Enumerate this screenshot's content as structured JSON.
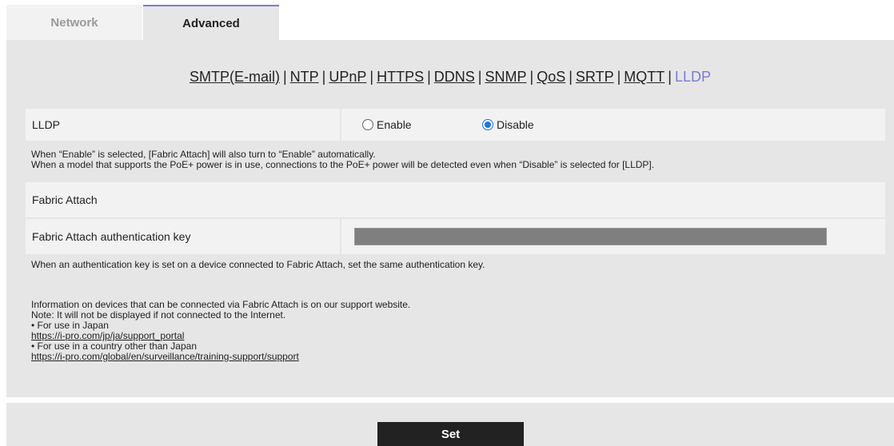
{
  "tabs": [
    {
      "label": "Network"
    },
    {
      "label": "Advanced"
    }
  ],
  "subnav": {
    "items": [
      "SMTP(E-mail)",
      "NTP",
      "UPnP",
      "HTTPS",
      "DDNS",
      "SNMP",
      "QoS",
      "SRTP",
      "MQTT",
      "LLDP"
    ],
    "separator": "|",
    "active": "LLDP"
  },
  "lldp": {
    "label": "LLDP",
    "options": [
      "Enable",
      "Disable"
    ],
    "selected": "Disable"
  },
  "notes": {
    "lldp_line1": "When “Enable” is selected, [Fabric Attach] will also turn to “Enable” automatically.",
    "lldp_line2": "When a model that supports the PoE+ power is in use, connections to the PoE+ power will be detected even when “Disable” is selected for [LLDP].",
    "auth_key": "When an authentication key is set on a device connected to Fabric Attach, set the same authentication key.",
    "info_line1": "Information on devices that can be connected via Fabric Attach is on our support website.",
    "info_line2": "Note: It will not be displayed if not connected to the Internet.",
    "japan_label": "• For use in Japan",
    "japan_link": "https://i-pro.com/jp/ja/support_portal",
    "other_label": "• For use in a country other than Japan",
    "other_link": "https://i-pro.com/global/en/surveillance/training-support/support"
  },
  "fabric_attach": {
    "label": "Fabric Attach"
  },
  "auth_key": {
    "label": "Fabric Attach authentication key",
    "value": ""
  },
  "actions": {
    "set_label": "Set"
  },
  "colors": {
    "panel": "#e6e6e6",
    "row": "#f2f2f2",
    "active_link": "#7b7bd9",
    "radio_accent": "#1a73e8",
    "button": "#222222"
  }
}
